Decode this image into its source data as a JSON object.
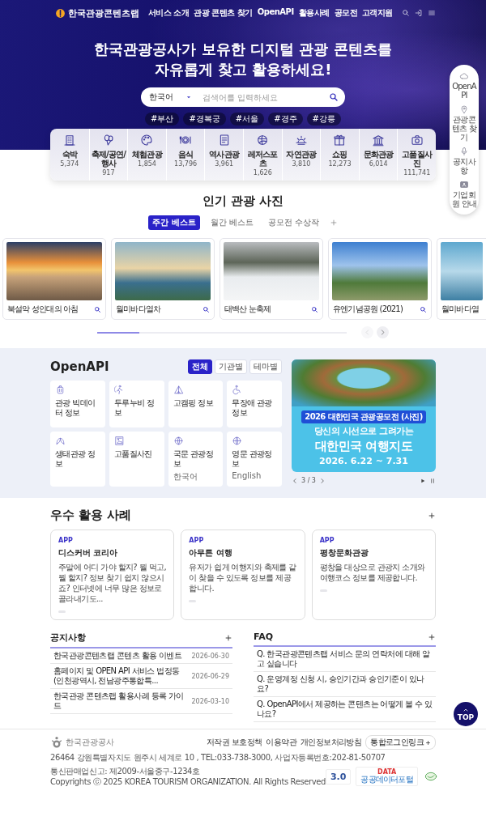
{
  "header": {
    "logo": "한국관광콘텐츠랩",
    "nav": [
      {
        "label": "서비스 소개"
      },
      {
        "label": "관광 콘텐츠 찾기"
      },
      {
        "label": "OpenAPI"
      },
      {
        "label": "활용사례"
      },
      {
        "label": "공모전"
      },
      {
        "label": "고객지원"
      }
    ]
  },
  "hero": {
    "title_lines": [
      "한국관광공사가 보유한 디지털 관광 콘텐츠를",
      "자유롭게 찾고 활용하세요!"
    ],
    "search": {
      "language": "한국어",
      "placeholder": "검색어를 입력하세요"
    },
    "tags": [
      "#부산",
      "#경복궁",
      "#서울",
      "#경주",
      "#강릉"
    ]
  },
  "quick_menu": [
    {
      "label": "OpenAPI"
    },
    {
      "label": "관광콘텐츠 찾기"
    },
    {
      "label": "공지사항"
    },
    {
      "label": "기업회원 안내"
    }
  ],
  "categories": [
    {
      "label": "숙박",
      "count": "5,374"
    },
    {
      "label": "축제/공연/행사",
      "count": "917"
    },
    {
      "label": "체험관광",
      "count": "1,854"
    },
    {
      "label": "음식",
      "count": "13,796"
    },
    {
      "label": "역사관광",
      "count": "3,961"
    },
    {
      "label": "레저스포츠",
      "count": "1,626"
    },
    {
      "label": "자연관광",
      "count": "3,810"
    },
    {
      "label": "쇼핑",
      "count": "12,273"
    },
    {
      "label": "문화관광",
      "count": "6,014"
    },
    {
      "label": "고품질사진",
      "count": "111,741"
    }
  ],
  "popular_photos": {
    "title": "인기 관광 사진",
    "tabs": [
      {
        "label": "주간 베스트",
        "selected": true
      },
      {
        "label": "월간 베스트",
        "selected": false
      },
      {
        "label": "공모전 수상작",
        "selected": false
      }
    ],
    "photos": [
      {
        "caption": "북설악 성인대의 아침",
        "cut": false
      },
      {
        "caption": "월미바다열차",
        "cut": false
      },
      {
        "caption": "태백산 눈축제",
        "cut": false
      },
      {
        "caption": "유엔기념공원 (2021)",
        "cut": false
      },
      {
        "caption": "월미바다열",
        "cut": true
      }
    ],
    "carousel": {
      "level": 0.17
    }
  },
  "openapi": {
    "title": "OpenAPI",
    "filters": [
      {
        "label": "전체",
        "selected": true
      },
      {
        "label": "기관별",
        "selected": false
      },
      {
        "label": "테마별",
        "selected": false
      }
    ],
    "apis": [
      {
        "name": "관광 빅데이터 정보"
      },
      {
        "name": "두루누비 정보"
      },
      {
        "name": "고캠핑 정보"
      },
      {
        "name": "무장애 관광정보"
      },
      {
        "name": "생태관광 정보"
      },
      {
        "name": "고품질사진"
      },
      {
        "name": "국문 관광정보",
        "note": "한국어"
      },
      {
        "name": "영문 관광정보",
        "note": "English"
      }
    ],
    "banner": {
      "badge": "2026 대한민국 관광공모전 (사진)",
      "subtitle": "당신의 시선으로 그려가는",
      "headline": "대한민국 여행지도",
      "dates": "2026. 6.22 ~ 7.31",
      "pager": "3 / 3"
    }
  },
  "cases": {
    "title": "우수 활용 사례",
    "items": [
      {
        "tag": "APP",
        "name": "디스커버 코리아",
        "description": "주말에 어디 가야 할지? 뭘 먹고, 뭘 할지? 정보 찾기 쉽지 않으시죠? 인터넷에 너무 많은 정보로 골라내기도..."
      },
      {
        "tag": "APP",
        "name": "아무튼 여행",
        "description": "유저가 쉽게 여행지와 축제를 같이 찾을 수 있도록 정보를 제공합니다."
      },
      {
        "tag": "APP",
        "name": "평창문화관광",
        "description": "평창을 대상으로 관광지 소개와 여행코스 정보를 제공합니다."
      }
    ]
  },
  "notices": {
    "title": "공지사항",
    "items": [
      {
        "title": "한국관광콘텐츠랩 콘텐츠 활용 이벤트",
        "date": "2026-06-30"
      },
      {
        "title": "홈페이지 및 OPEN API 서비스 법정동(인천광역시, 전남광주통합특...",
        "date": "2026-06-29"
      },
      {
        "title": "한국관광 콘텐츠랩 활용사례 등록 가이드",
        "date": "2026-03-10"
      }
    ]
  },
  "faq": {
    "title": "FAQ",
    "items": [
      {
        "question": "Q. 한국관광콘텐츠랩 서비스 문의 연락처에 대해 알고 싶습니다"
      },
      {
        "question": "Q. 운영계정 신청 시, 승인기간과 승인기준이 있나요?"
      },
      {
        "question": "Q. OpenAPI에서 제공하는 콘텐츠는 어떻게 볼 수 있나요?"
      }
    ]
  },
  "footer": {
    "logo": "한국관광공사",
    "address_lines": [
      "26464 강원특별자치도 원주시 세계로 10 , TEL:033-738-3000, 사업자등록번호:202-81-50707",
      "통신판매업신고: 제2009-서울중구-1234호",
      "Copyrights ⓒ 2025 KOREA TOURISM ORGANIZATION. All Rights Reserved"
    ],
    "links": [
      "저작권 보호정책",
      "이용약관",
      "개인정보처리방침"
    ],
    "login_link": "통합로그인링크",
    "badges": [
      {
        "kind": "grade",
        "text": "3.0"
      },
      {
        "kind": "portal",
        "mark": "DATA",
        "text": "공공데이터포털"
      },
      {
        "kind": "seal"
      }
    ],
    "top_button": "TOP"
  }
}
